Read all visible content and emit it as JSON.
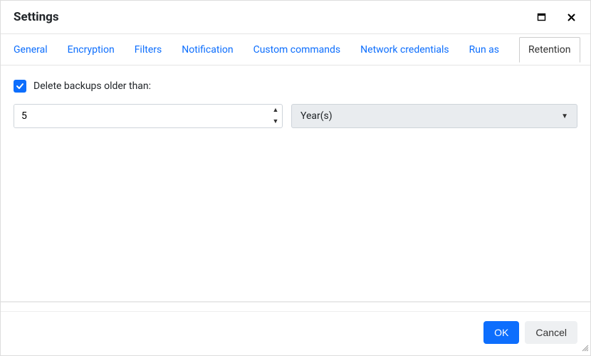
{
  "header": {
    "title": "Settings"
  },
  "tabs": {
    "general": "General",
    "encryption": "Encryption",
    "filters": "Filters",
    "notification": "Notification",
    "custom_commands": "Custom commands",
    "network_credentials": "Network credentials",
    "run_as": "Run as",
    "retention": "Retention"
  },
  "retention": {
    "delete_label": "Delete backups older than:",
    "value": "5",
    "unit_selected": "Year(s)"
  },
  "footer": {
    "ok": "OK",
    "cancel": "Cancel"
  }
}
